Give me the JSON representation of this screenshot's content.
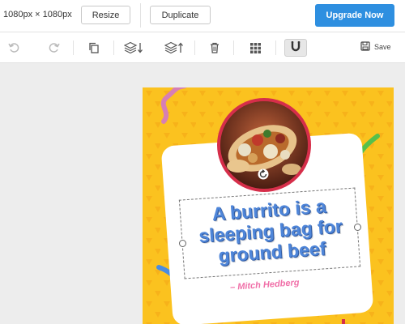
{
  "header": {
    "dimensions": "1080px × 1080px",
    "resize_label": "Resize",
    "duplicate_label": "Duplicate",
    "upgrade_label": "Upgrade Now"
  },
  "toolbar": {
    "save_label": "Save",
    "tools": [
      "undo-icon",
      "redo-icon",
      "copy-icon",
      "layer-down-icon",
      "layer-up-icon",
      "trash-icon",
      "grid-icon",
      "magnet-icon",
      "save-icon"
    ]
  },
  "design": {
    "quote_lines": [
      "A burrito is a",
      "sleeping bag for",
      "ground beef"
    ],
    "author": "– Mitch Hedberg",
    "colors": {
      "background": "#fbc21f",
      "quote": "#4f86d9",
      "author": "#f06fa8",
      "photo_ring": "#d62e4a",
      "accent_blue": "#2e8fe0"
    }
  }
}
